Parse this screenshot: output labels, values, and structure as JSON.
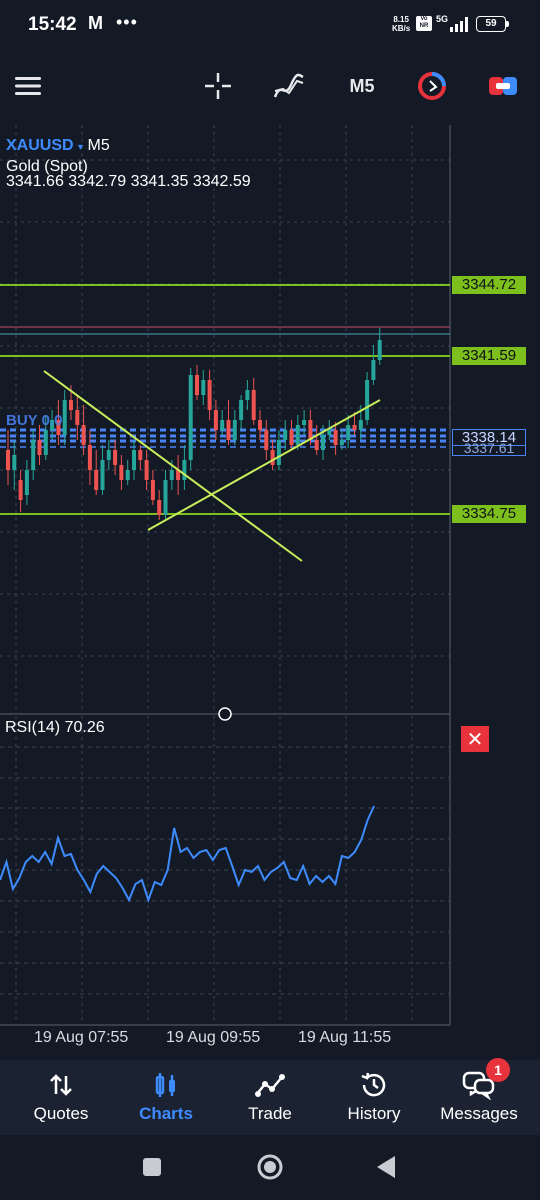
{
  "status_bar": {
    "time": "15:42",
    "app_glyph": "M",
    "dots": "•••",
    "net_speed_value": "8.15",
    "net_speed_unit": "KB/s",
    "network": "5G",
    "volte": "Vo NR",
    "battery": "59"
  },
  "toolbar": {
    "timeframe": "M5",
    "icons": [
      "menu-icon",
      "crosshair-icon",
      "indicators-icon",
      "timeframe",
      "one-click-trading-icon",
      "chart-toggle-icon"
    ]
  },
  "chart": {
    "symbol": "XAUUSD",
    "symbol_caret": "▾",
    "timeframe": "M5",
    "instrument_name": "Gold (Spot)",
    "ohlc": "3341.66 3342.79 3341.35 3342.59",
    "price_levels": {
      "level_1": "3344.72",
      "level_2": "3341.59",
      "bid": "3338.14",
      "ask": "3337.61",
      "level_3": "3334.75"
    },
    "order_line_label": "BUY 0.0",
    "rsi_label": "RSI(14) 70.26",
    "time_labels": [
      "19 Aug 07:55",
      "19 Aug 09:55",
      "19 Aug 11:55"
    ],
    "colors": {
      "background": "#131a26",
      "up_candle": "#26a69a",
      "down_candle": "#ef5350",
      "level_lines": "#7dc01e",
      "trendlines": "#c8ee5a",
      "order_lines": "#4a84f5",
      "rsi_line": "#3d8bfd"
    }
  },
  "bottom_nav": {
    "items": [
      {
        "label": "Quotes",
        "icon": "quotes-icon"
      },
      {
        "label": "Charts",
        "icon": "charts-icon"
      },
      {
        "label": "Trade",
        "icon": "trade-icon"
      },
      {
        "label": "History",
        "icon": "history-icon"
      },
      {
        "label": "Messages",
        "icon": "messages-icon"
      }
    ],
    "active": "Charts",
    "messages_badge": "1"
  }
}
